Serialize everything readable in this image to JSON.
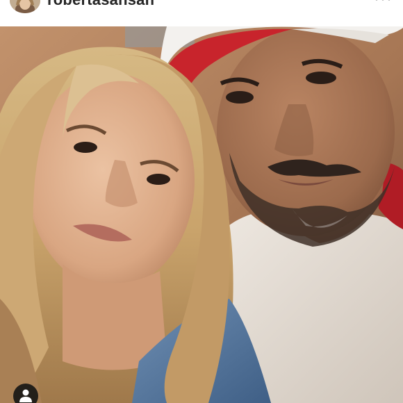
{
  "post": {
    "username": "robertasansan",
    "more_icon": "more-horizontal-icon",
    "user_tag_icon": "person-icon"
  },
  "colors": {
    "header_background": "#ffffff",
    "username_text": "#262626",
    "cap_red": "#c8242c",
    "cap_white": "#f3f1ee"
  }
}
